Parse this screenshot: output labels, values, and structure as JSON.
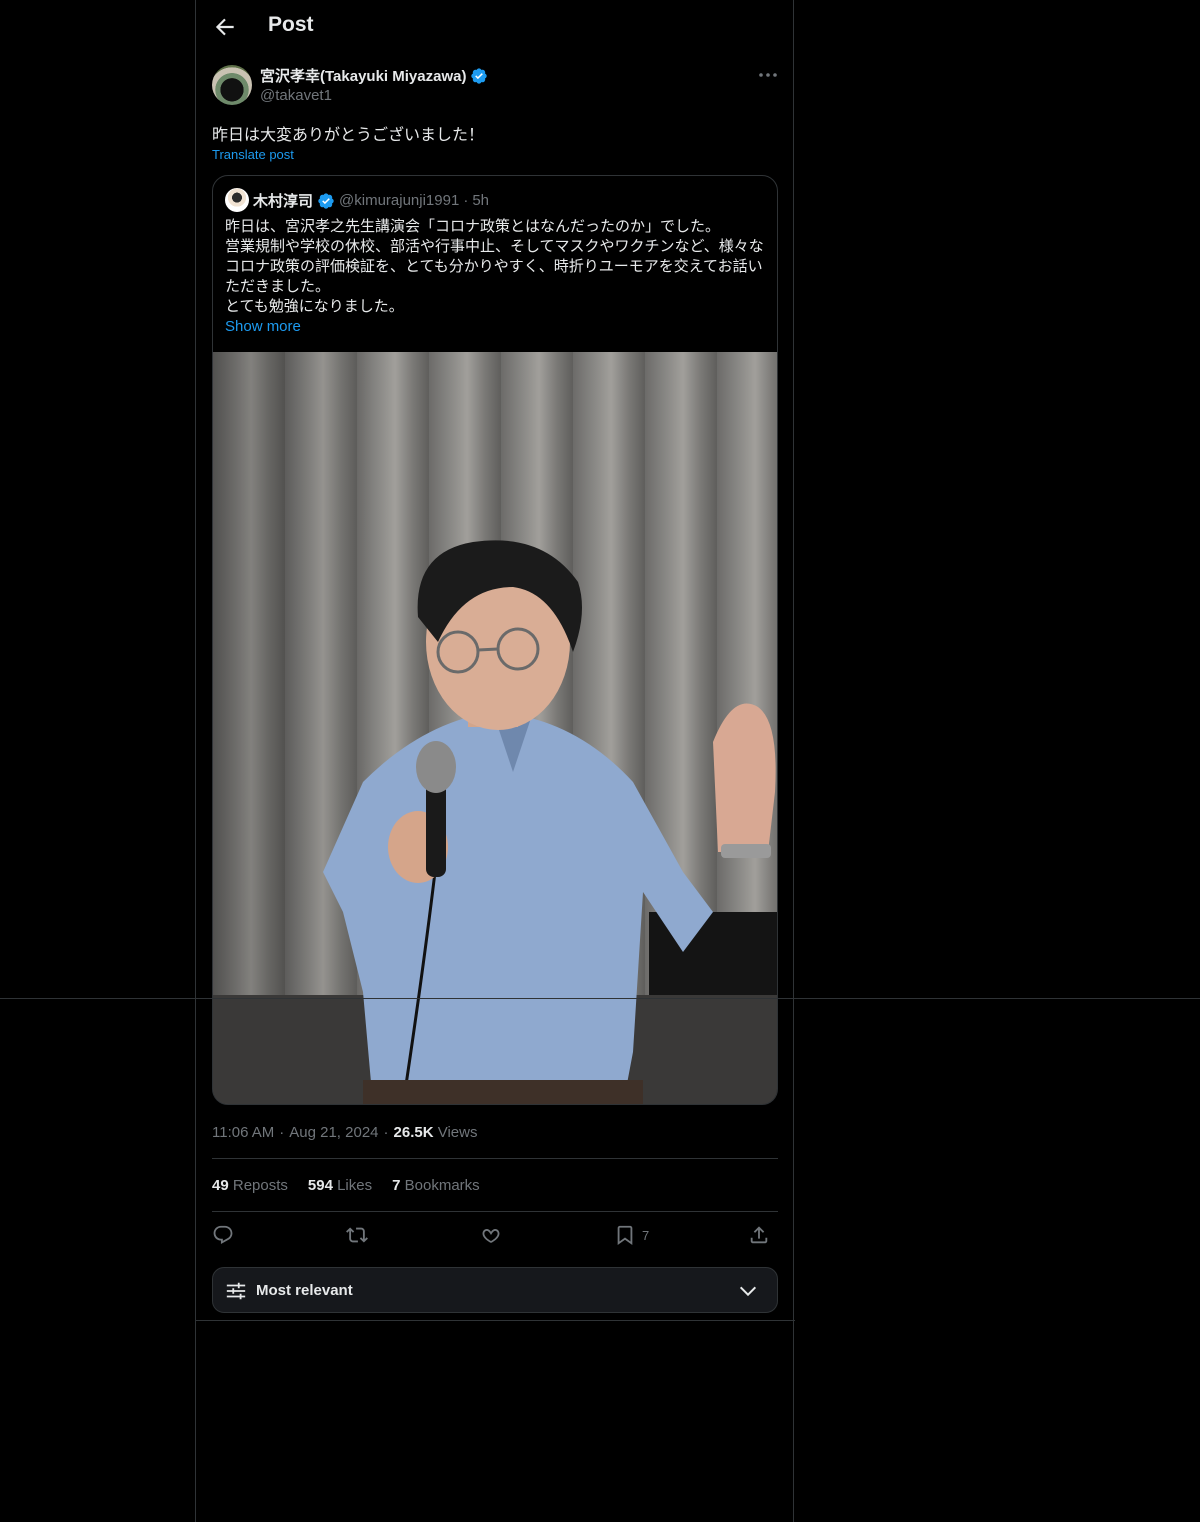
{
  "header": {
    "title": "Post"
  },
  "author": {
    "name": "宮沢孝幸(Takayuki Miyazawa)",
    "handle": "@takavet1",
    "verified": true
  },
  "post": {
    "text": "昨日は大変ありがとうございました！",
    "translate_label": "Translate post"
  },
  "quote": {
    "name": "木村淳司",
    "handle": "@kimurajunji1991",
    "separator": "·",
    "time": "5h",
    "lines": [
      "昨日は、宮沢孝之先生講演会「コロナ政策とはなんだったのか」でした。",
      "営業規制や学校の休校、部活や行事中止、そしてマスクやワクチンなど、様々な",
      "コロナ政策の評価検証を、とても分かりやすく、時折りユーモアを交えてお話い",
      "ただきました。",
      "とても勉強になりました。"
    ],
    "show_more": "Show more"
  },
  "meta": {
    "time": "11:06 AM",
    "dot1": "·",
    "date": "Aug 21, 2024",
    "dot2": "·",
    "views_count": "26.5K",
    "views_label": "Views"
  },
  "stats": {
    "reposts_count": "49",
    "reposts_label": "Reposts",
    "likes_count": "594",
    "likes_label": "Likes",
    "bookmarks_count": "7",
    "bookmarks_label": "Bookmarks"
  },
  "actions": {
    "bookmark_count": "7"
  },
  "sort": {
    "label": "Most relevant"
  },
  "colors": {
    "accent": "#1d9bf0",
    "background": "#000000",
    "border": "#2f3336",
    "muted": "#71767b"
  },
  "icons": [
    "back-arrow-icon",
    "verified-badge-icon",
    "more-icon",
    "reply-icon",
    "repost-icon",
    "like-icon",
    "bookmark-icon",
    "share-icon",
    "filter-icon",
    "chevron-down-icon"
  ]
}
